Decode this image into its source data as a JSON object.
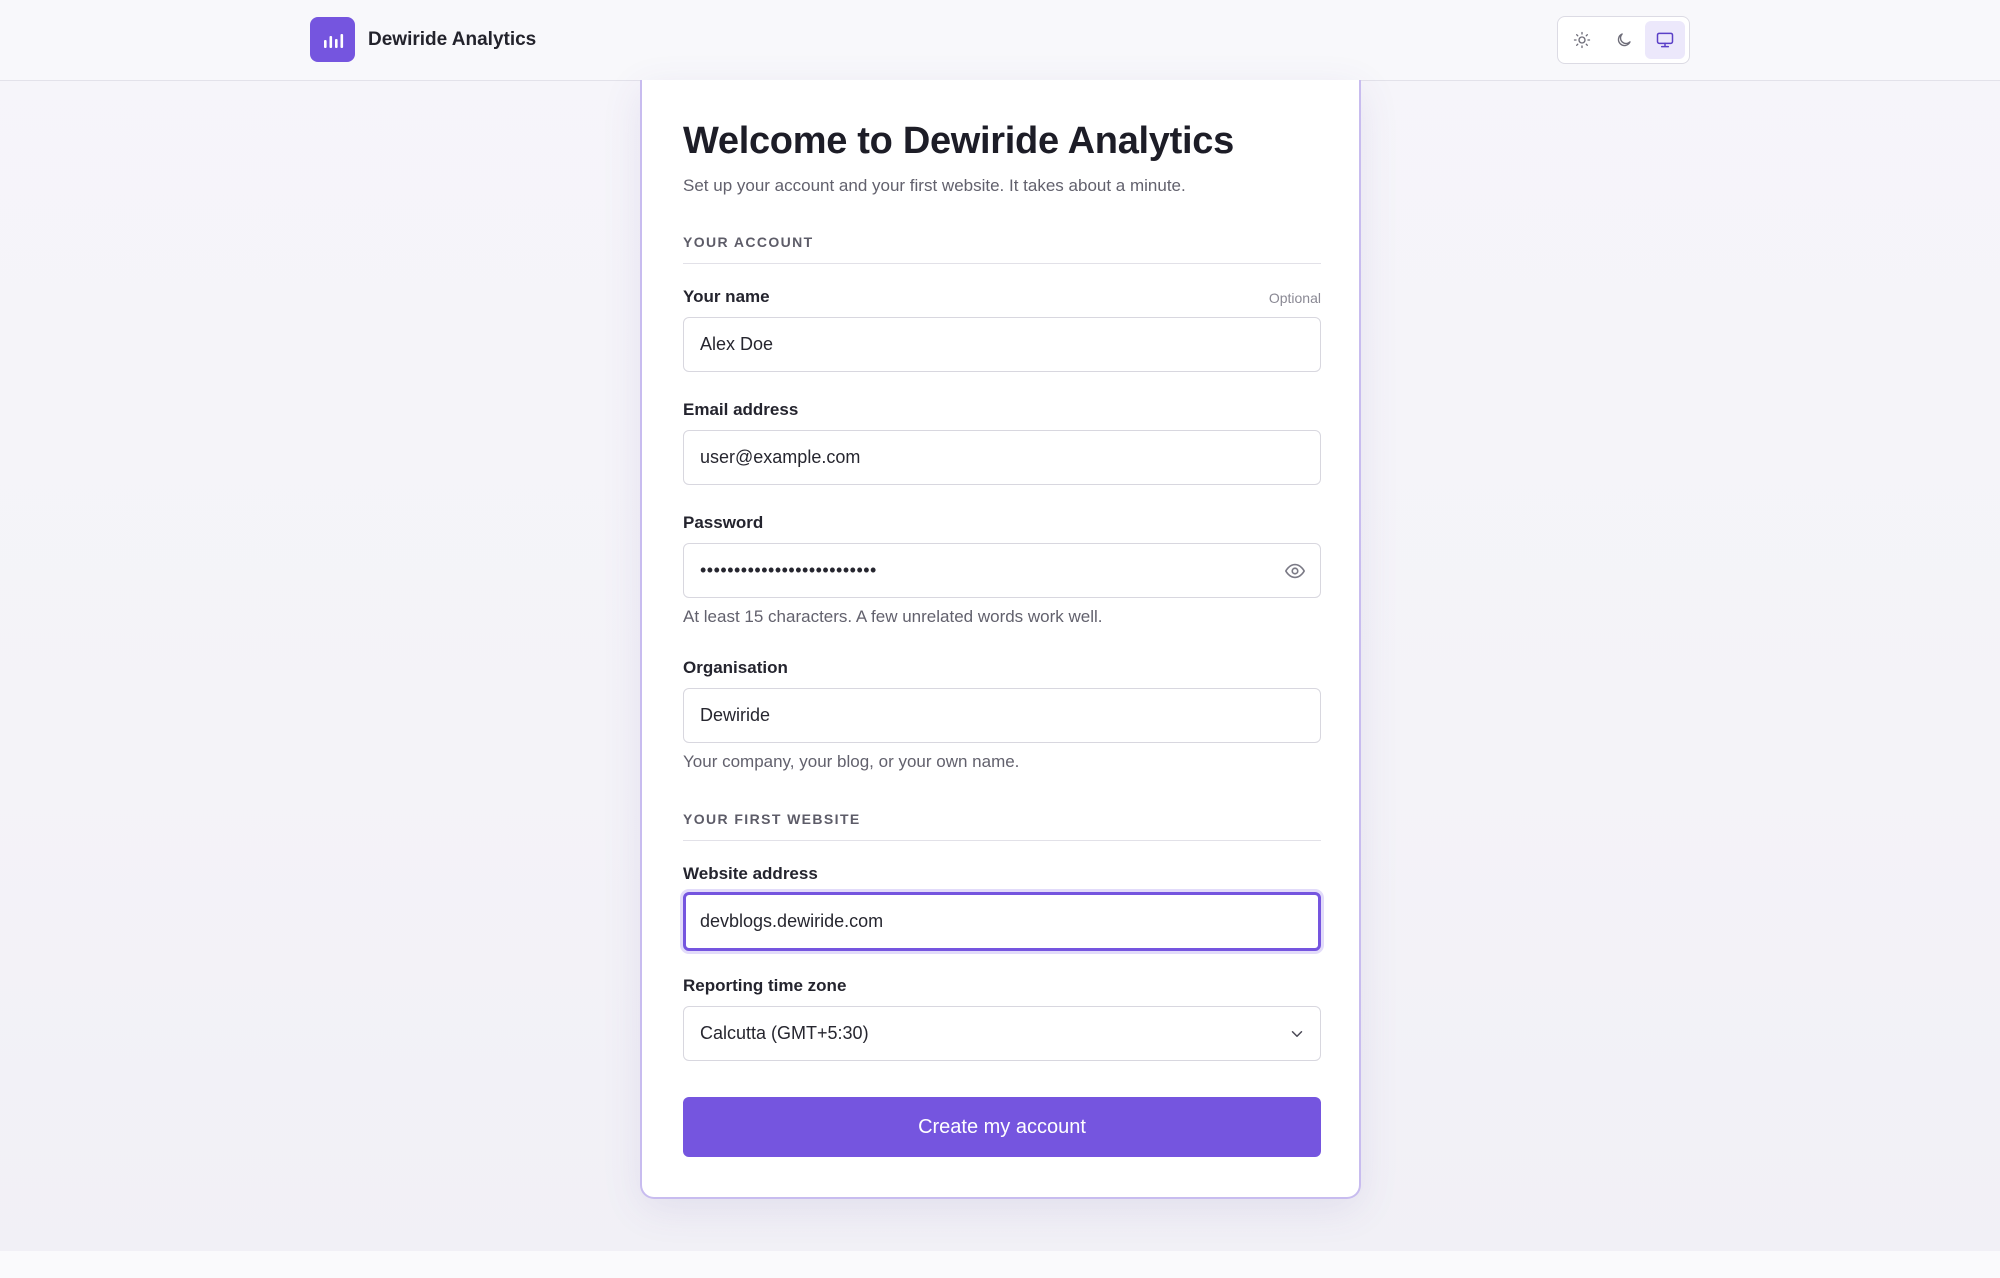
{
  "header": {
    "brand_name": "Dewiride Analytics",
    "logo_icon": "bar-chart-icon",
    "theme_options": [
      "light",
      "dark",
      "system"
    ],
    "theme_selected": "system"
  },
  "form": {
    "title": "Welcome to Dewiride Analytics",
    "subtitle": "Set up your account and your first website. It takes about a minute.",
    "section_account": "YOUR ACCOUNT",
    "name": {
      "label": "Your name",
      "optional": "Optional",
      "value": "Alex Doe"
    },
    "email": {
      "label": "Email address",
      "value": "user@example.com"
    },
    "password": {
      "label": "Password",
      "masked_value": "••••••••••••••••••••••••••",
      "help": "At least 15 characters. A few unrelated words work well."
    },
    "organisation": {
      "label": "Organisation",
      "value": "Dewiride",
      "help": "Your company, your blog, or your own name."
    },
    "section_website": "YOUR FIRST WEBSITE",
    "website": {
      "label": "Website address",
      "value": "devblogs.dewiride.com"
    },
    "timezone": {
      "label": "Reporting time zone",
      "value": "Calcutta (GMT+5:30)"
    },
    "submit_label": "Create my account"
  },
  "colors": {
    "accent": "#7555df",
    "accent_soft": "#ece8fb"
  }
}
